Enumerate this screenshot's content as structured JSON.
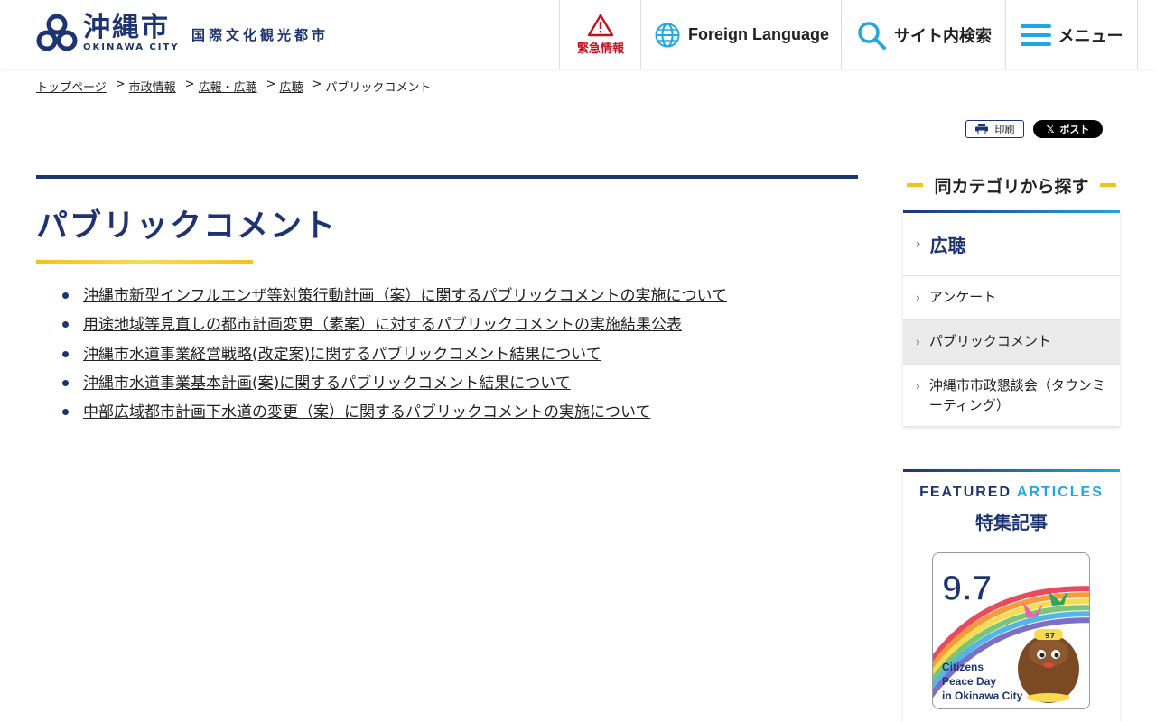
{
  "header": {
    "logo_name": "沖縄市",
    "logo_en": "OKINAWA CITY",
    "tagline": "国際文化観光都市",
    "emergency_label": "緊急情報",
    "language_label": "Foreign Language",
    "search_label": "サイト内検索",
    "menu_label": "メニュー",
    "colors": {
      "brand": "#1e3471",
      "accent": "#1fa8e0",
      "alert": "#c1121f",
      "gold": "#f0c419"
    }
  },
  "breadcrumb": {
    "items": [
      "トップページ",
      "市政情報",
      "広報・広聴",
      "広聴"
    ],
    "separator": ">",
    "current": "パブリックコメント"
  },
  "tools": {
    "print_label": "印刷",
    "post_label": "ポスト",
    "post_icon": "x-logo-icon",
    "print_icon": "printer-icon"
  },
  "main": {
    "title": "パブリックコメント",
    "links": [
      "沖縄市新型インフルエンザ等対策行動計画（案）に関するパブリックコメントの実施について",
      "用途地域等見直しの都市計画変更（素案）に対するパブリックコメントの実施結果公表",
      "沖縄市水道事業経営戦略(改定案)に関するパブリックコメント結果について",
      "沖縄市水道事業基本計画(案)に関するパブリックコメント結果について",
      "中部広域都市計画下水道の変更（案）に関するパブリックコメントの実施について"
    ]
  },
  "sidebar": {
    "heading": "同カテゴリから探す",
    "parent": "広聴",
    "items": [
      "アンケート",
      "パブリックコメント",
      "沖縄市市政懇談会（タウンミーティング）"
    ],
    "current_index": 1
  },
  "featured": {
    "en_part1": "FEATURED",
    "en_part2": "ARTICLES",
    "ja": "特集記事",
    "banner": {
      "big_number": "9.7",
      "line1": "Citizens",
      "line2": "Peace Day",
      "line3": "in Okinawa City",
      "badge": "97"
    }
  }
}
